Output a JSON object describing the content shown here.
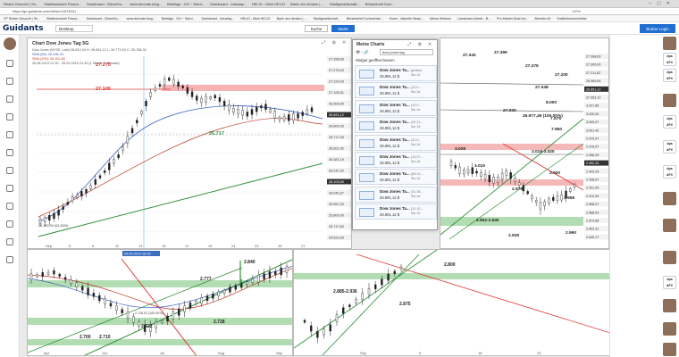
{
  "browser": {
    "tabs": [
      "Reden Gesucht | Se...",
      "Stadtnetzwerk Finanz...",
      "Dashboard - BörseGo...",
      "www.derivate.blog...",
      "Beiträge - GO ~ Word...",
      "Dashboard - Intraday...",
      "HELIO - Mein HELIO",
      "Bank neu denken | ...",
      "Stadtgesellschaft...",
      "Börsenbrief Kom..."
    ],
    "url": "https://go.guidants.com/de/#c/14374531",
    "zoom": "110%",
    "bookmarks": [
      "YP Reden Gesucht | Se...",
      "Stadtnetzwerk Finanz...",
      "Dashboard - BörseGo...",
      "www.derivate.blog...",
      "Beiträge - GO ~ Word...",
      "Dashboard - Intraday...",
      "HELIO - Mein HELIO",
      "Bank neu denken | ...",
      "Stadtgesellschaft...",
      "Börsenbrief Kommentar...",
      "Home - Aktuelle News...",
      "Meine Widmen",
      "Livestream Admin - B...",
      "Pro Market Most Act...",
      "Börsello 40",
      "Kraftbörsenschreiber"
    ]
  },
  "header": {
    "logo": "Guidants",
    "desktop_label": "Desktop",
    "search_label": "Suche",
    "market_label": "Markt",
    "broker_label": "Broker Login"
  },
  "colors": {
    "accent": "#1f6fd1",
    "resistance": "#e23b3b",
    "support": "#2f8f3a",
    "sma_red": "#c0392b",
    "sma_blue": "#3a5ec0",
    "zone_red": "#f3a6a6",
    "zone_green": "#9fd39d"
  },
  "chart_main": {
    "title": "Chart Dow Jones Tag 5G",
    "legend": [
      "Dow Jones (NYSE, Last) 26.813,34 H: 26.891,12 L: 26.773,00 C: 26.788,32",
      "SMA (50): 26.496,33",
      "SMA (200): 26.152,80",
      "26.08.2019 21:30 - 26.09.2019 21:30 (1 Monat, 1 Monate)"
    ],
    "annotations": [
      "27.275",
      "27.105",
      "26.717",
      "26.183,00 (61,80%)"
    ],
    "price_labels": [
      "27.398,69",
      "27.275,00",
      "27.229,03",
      "27.105,01",
      "26.900,00",
      "26.891,12",
      "26.800,00",
      "26.717,05",
      "26.602,42",
      "26.387,19",
      "26.241,42",
      "26.109,69",
      "26.043,37",
      "25.957,03",
      "25.800,00",
      "25.717,63",
      "25.523,39"
    ],
    "x_ticks": [
      "Sep",
      "5",
      "9",
      "11",
      "13",
      "15",
      "17",
      "19",
      "21",
      "23",
      "25",
      "27"
    ]
  },
  "chart_lower": {
    "annotations": [
      "2.777",
      "2.728",
      "2.722",
      "2.700",
      "2.710",
      "2.840",
      "2.728,01 (100,00%)",
      "09.09.2019 18:30"
    ],
    "x_ticks": [
      "Apr",
      "Jun",
      "Jul",
      "Aug",
      "Sep"
    ]
  },
  "chart_lower_mid": {
    "annotations": [
      "2.800",
      "2.885-2.936",
      "2.875"
    ],
    "x_ticks": [
      "Sep",
      "9",
      "16",
      "23"
    ]
  },
  "chart_right": {
    "annotations": [
      "27.399",
      "27.342",
      "27.275",
      "27.200",
      "27.048",
      "27.000",
      "26.977,49 (100,00%)",
      "8.000",
      "7.975",
      "7.950",
      "3.018-3.020",
      "3.028",
      "3.010",
      "3.000",
      "2.979",
      "2.958",
      "2.952-2.940",
      "2.939",
      "2.990"
    ],
    "price_labels": [
      "27.398,69",
      "27.300,00",
      "27.211,82",
      "26.969,94",
      "26.891,12",
      "27.953,10",
      "3.027,86",
      "3.020,00",
      "3.009,57",
      "3.001,42",
      "2.979,57",
      "2.978,57",
      "2.958,09",
      "2.952,45",
      "2.943,99",
      "2.938,67",
      "2.931,00",
      "2.912,99",
      "2.898,07",
      "2.888,53",
      "2.874,88",
      "2.853,31",
      "2.845,17"
    ]
  },
  "my_charts": {
    "title": "Meine Charts",
    "filter_value": "dow jones tag",
    "open_widget_label": "Widget geöffnet lassen",
    "items": [
      {
        "name": "Dow Jones Ta...",
        "price": "26.891,12 $",
        "date": "gestern",
        "tf": "5m,1d"
      },
      {
        "name": "Dow Jones Ta...",
        "price": "26.891,12 $",
        "date": "(22.0...",
        "tf": "5m,1d"
      },
      {
        "name": "Dow Jones Ta...",
        "price": "26.891,12 $",
        "date": "(10.0...",
        "tf": "5m,1d"
      },
      {
        "name": "Dow Jones Ta...",
        "price": "26.891,12 $",
        "date": "(02.11...",
        "tf": "5m,1d"
      },
      {
        "name": "Dow Jones Ta...",
        "price": "26.891,12 $",
        "date": "(21.0...",
        "tf": "5m,1d"
      },
      {
        "name": "Dow Jones Ta...",
        "price": "26.891,12 $",
        "date": "(14.07...",
        "tf": "5m,1d"
      },
      {
        "name": "Dow Jones Ta...",
        "price": "26.891,12 $",
        "date": "(08.12...",
        "tf": "5m,1d"
      },
      {
        "name": "Dow Jones Ta...",
        "price": "26.891,12 $",
        "date": "(21.08...",
        "tf": "5m,1d"
      },
      {
        "name": "Dow Jones Ta...",
        "price": "26.891,12 $",
        "date": "(31.10...",
        "tf": "5m,1d"
      }
    ]
  },
  "right_rail": {
    "logos": [
      "dpa AFX",
      "dpa AFX",
      "dpa AFX",
      "dpa AFX",
      "dpa AFX",
      "dpa AFX"
    ]
  }
}
